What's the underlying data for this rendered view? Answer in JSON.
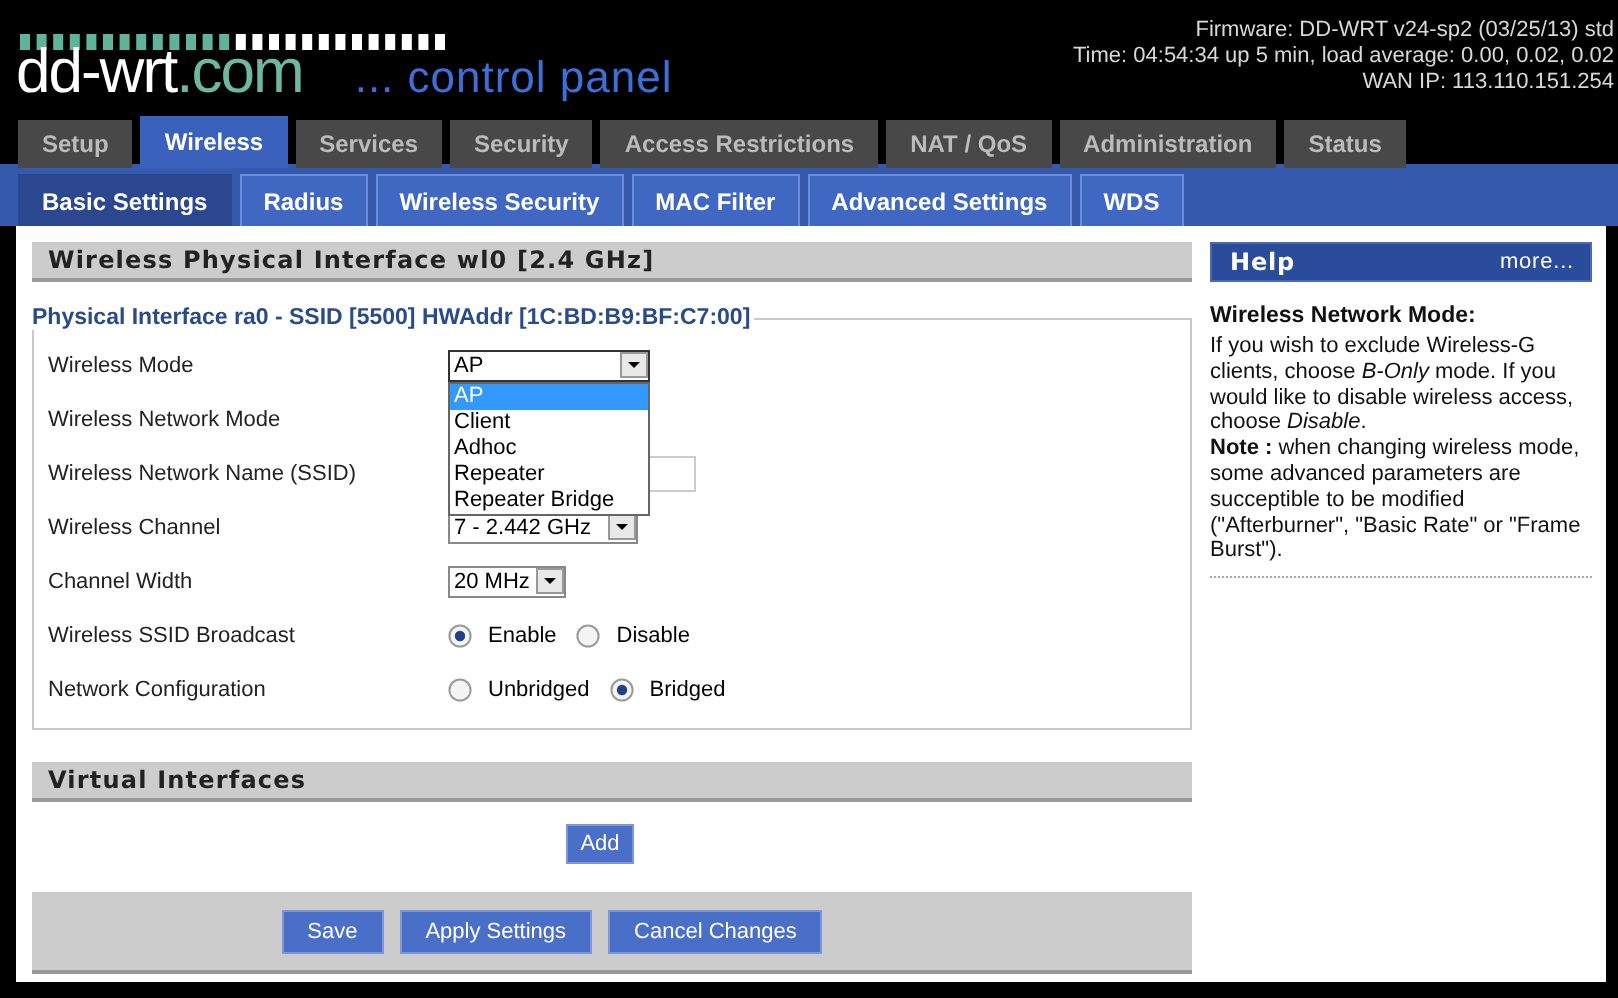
{
  "header": {
    "logo_main": "dd-wrt",
    "logo_suffix": ".com",
    "tagline": "... control panel",
    "status": [
      "Firmware: DD-WRT v24-sp2 (03/25/13) std",
      "Time: 04:54:34 up 5 min, load average: 0.00, 0.02, 0.02",
      "WAN IP: 113.110.151.254"
    ]
  },
  "tabs": [
    {
      "label": "Setup",
      "selected": false
    },
    {
      "label": "Wireless",
      "selected": true
    },
    {
      "label": "Services",
      "selected": false
    },
    {
      "label": "Security",
      "selected": false
    },
    {
      "label": "Access Restrictions",
      "selected": false
    },
    {
      "label": "NAT / QoS",
      "selected": false
    },
    {
      "label": "Administration",
      "selected": false
    },
    {
      "label": "Status",
      "selected": false
    }
  ],
  "subtabs": [
    {
      "label": "Basic Settings",
      "selected": true
    },
    {
      "label": "Radius",
      "selected": false
    },
    {
      "label": "Wireless Security",
      "selected": false
    },
    {
      "label": "MAC Filter",
      "selected": false
    },
    {
      "label": "Advanced Settings",
      "selected": false
    },
    {
      "label": "WDS",
      "selected": false
    }
  ],
  "section": {
    "title": "Wireless Physical Interface wl0 [2.4 GHz]",
    "legend": "Physical Interface ra0 - SSID [5500] HWAddr [1C:BD:B9:BF:C7:00]",
    "rows": [
      {
        "label": "Wireless Mode",
        "kind": "select",
        "value": "AP",
        "expanded": true,
        "options": [
          {
            "label": "AP",
            "selected": true
          },
          {
            "label": "Client",
            "selected": false
          },
          {
            "label": "Adhoc",
            "selected": false
          },
          {
            "label": "Repeater",
            "selected": false
          },
          {
            "label": "Repeater Bridge",
            "selected": false
          }
        ]
      },
      {
        "label": "Wireless Network Mode",
        "kind": "covered"
      },
      {
        "label": "Wireless Network Name (SSID)",
        "kind": "text"
      },
      {
        "label": "Wireless Channel",
        "kind": "select",
        "value": "7 - 2.442 GHz"
      },
      {
        "label": "Channel Width",
        "kind": "select",
        "value": "20 MHz"
      },
      {
        "label": "Wireless SSID Broadcast",
        "kind": "radio",
        "options": [
          {
            "label": "Enable",
            "selected": true
          },
          {
            "label": "Disable",
            "selected": false
          }
        ]
      },
      {
        "label": "Network Configuration",
        "kind": "radio",
        "options": [
          {
            "label": "Unbridged",
            "selected": false
          },
          {
            "label": "Bridged",
            "selected": true
          }
        ]
      }
    ]
  },
  "virtual": {
    "title": "Virtual Interfaces",
    "add_button": "Add"
  },
  "buttons": [
    "Save",
    "Apply Settings",
    "Cancel Changes"
  ],
  "help": {
    "title": "Help",
    "more": "more...",
    "heading": "Wireless Network Mode:",
    "paragraphs": [
      "If you wish to exclude Wireless-G clients, choose *B-Only* mode. If you would like to disable wireless access, choose *Disable*.",
      "**Note :** when changing wireless mode, some advanced parameters are succeptible to be modified (\"Afterburner\", \"Basic Rate\" or \"Frame Burst\")."
    ]
  }
}
